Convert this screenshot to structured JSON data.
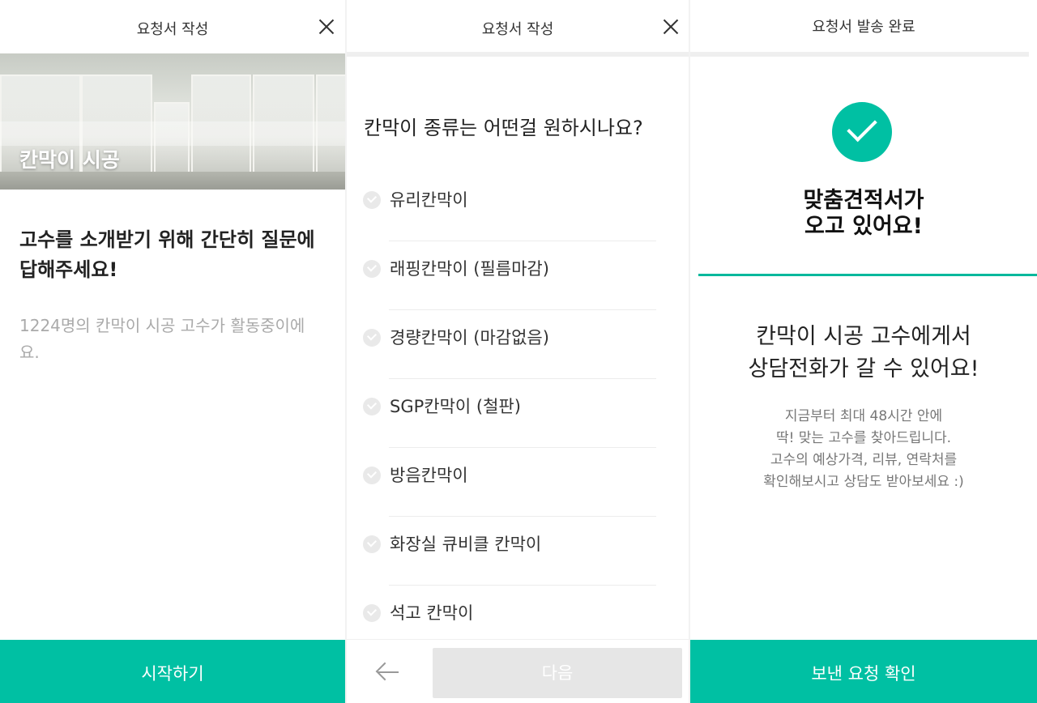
{
  "panel1": {
    "title": "요청서 작성",
    "hero_label": "칸막이 시공",
    "intro_line1": "고수를 소개받기 위해 간단히 질문에",
    "intro_line2": "답해주세요!",
    "sub_line1": "1224명의 칸막이 시공 고수가 활동중이에",
    "sub_line2": "요.",
    "cta_label": "시작하기",
    "accent": "#00c0a3"
  },
  "panel2": {
    "title": "요청서 작성",
    "question": "칸막이 종류는 어떤걸 원하시나요?",
    "options": [
      {
        "label": "유리칸막이"
      },
      {
        "label": "래핑칸막이 (필름마감)"
      },
      {
        "label": "경량칸막이 (마감없음)"
      },
      {
        "label": "SGP칸막이 (철판)"
      },
      {
        "label": "방음칸막이"
      },
      {
        "label": "화장실 큐비클 칸막이"
      },
      {
        "label": "석고 칸막이"
      }
    ],
    "next_label": "다음",
    "back_icon": "arrow-left-icon"
  },
  "panel3": {
    "title": "요청서 발송 완료",
    "headline_line1": "맞춤견적서가",
    "headline_line2": "오고 있어요!",
    "headline2_line1": "칸막이 시공 고수에게서",
    "headline2_line2": "상담전화가 갈 수 있어요!",
    "desc_lines": [
      "지금부터 최대 48시간 안에",
      "딱! 맞는 고수를 찾아드립니다.",
      "고수의 예상가격, 리뷰, 연락처를",
      "확인해보시고 상담도 받아보세요 :)"
    ],
    "cta_label": "보낸 요청 확인"
  }
}
